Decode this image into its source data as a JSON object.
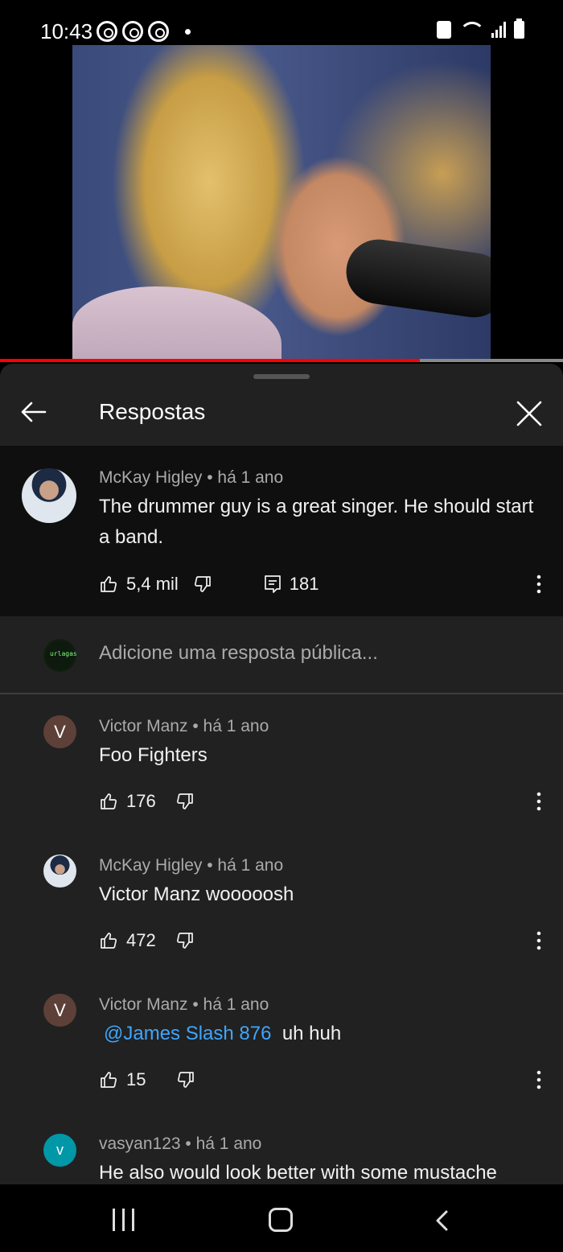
{
  "status_bar": {
    "time": "10:43"
  },
  "video": {
    "progress_fraction": 0.745
  },
  "header": {
    "title": "Respostas"
  },
  "parent_comment": {
    "author": "McKay Higley",
    "time": "há 1 ano",
    "text": "The drummer guy is a great singer. He should start a band.",
    "likes": "5,4 mil",
    "replies": "181"
  },
  "reply_input": {
    "placeholder": "Adicione uma resposta pública...",
    "avatar_text": "urlagas_"
  },
  "replies": [
    {
      "author": "Victor Manz",
      "time": "há 1 ano",
      "text": "Foo Fighters",
      "likes": "176",
      "avatar_letter": "V",
      "avatar_color": "#5d4037"
    },
    {
      "author": "McKay Higley",
      "time": "há 1 ano",
      "text": "Victor Manz wooooosh",
      "likes": "472"
    },
    {
      "author": "Victor Manz",
      "time": "há 1 ano",
      "mention": "@James Slash 876",
      "text": "uh huh",
      "likes": "15",
      "avatar_letter": "V",
      "avatar_color": "#5d4037"
    },
    {
      "author": "vasyan123",
      "time": "há 1 ano",
      "text": "He also would look better with some mustache",
      "avatar_letter": "V",
      "avatar_color": "#0097a7"
    }
  ],
  "colors": {
    "accent_link": "#3ea6ff",
    "progress": "#ff0000",
    "sheet_bg": "#212121",
    "parent_bg": "#0f0f0f"
  }
}
